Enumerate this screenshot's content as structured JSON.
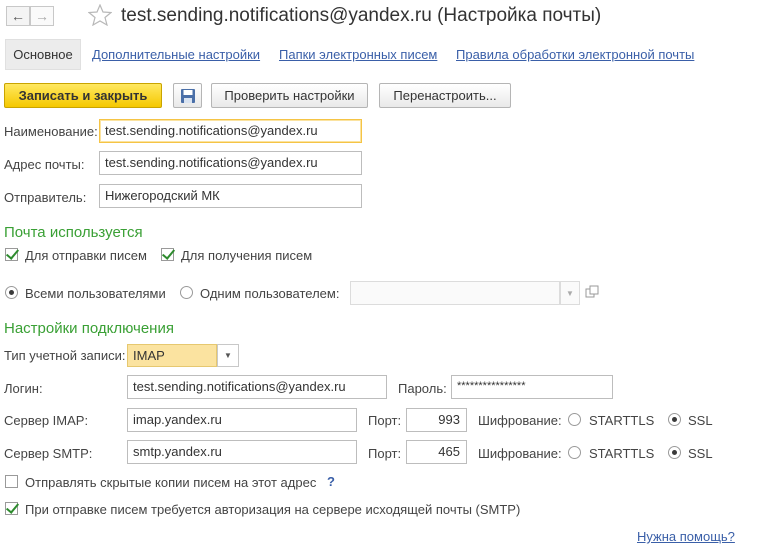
{
  "window": {
    "title": "test.sending.notifications@yandex.ru (Настройка почты)"
  },
  "tabs": [
    {
      "label": "Основное"
    },
    {
      "label": "Дополнительные настройки"
    },
    {
      "label": "Папки электронных писем"
    },
    {
      "label": "Правила обработки электронной почты"
    }
  ],
  "toolbar": {
    "save_close": "Записать и закрыть",
    "check_settings": "Проверить настройки",
    "reconfigure": "Перенастроить..."
  },
  "form": {
    "name_label": "Наименование:",
    "name_value": "test.sending.notifications@yandex.ru",
    "address_label": "Адрес почты:",
    "address_value": "test.sending.notifications@yandex.ru",
    "sender_label": "Отправитель:",
    "sender_value": "Нижегородский МК"
  },
  "usage": {
    "header": "Почта используется",
    "send_label": "Для отправки писем",
    "send_checked": true,
    "receive_label": "Для получения писем",
    "receive_checked": true,
    "all_users_label": "Всеми пользователями",
    "one_user_label": "Одним пользователем:",
    "one_user_value": ""
  },
  "connection": {
    "header": "Настройки подключения",
    "account_type_label": "Тип учетной записи:",
    "account_type_value": "IMAP",
    "login_label": "Логин:",
    "login_value": "test.sending.notifications@yandex.ru",
    "password_label": "Пароль:",
    "password_value": "****************",
    "imap_label": "Сервер IMAP:",
    "imap_value": "imap.yandex.ru",
    "imap_port_label": "Порт:",
    "imap_port": "993",
    "imap_enc_label": "Шифрование:",
    "smtp_label": "Сервер SMTP:",
    "smtp_value": "smtp.yandex.ru",
    "smtp_port_label": "Порт:",
    "smtp_port": "465",
    "smtp_enc_label": "Шифрование:",
    "starttls": "STARTTLS",
    "ssl": "SSL"
  },
  "options": {
    "bcc_label": "Отправлять скрытые копии писем на этот адрес",
    "bcc_help": "?",
    "auth_label": "При отправке писем требуется авторизация на сервере исходящей почты (SMTP)"
  },
  "footer": {
    "help_link": "Нужна помощь?"
  },
  "icons": {
    "back": "arrow-left",
    "forward": "arrow-right",
    "favorite": "star-outline",
    "save": "floppy-disk",
    "dropdown": "chevron-down",
    "open": "open-window"
  }
}
